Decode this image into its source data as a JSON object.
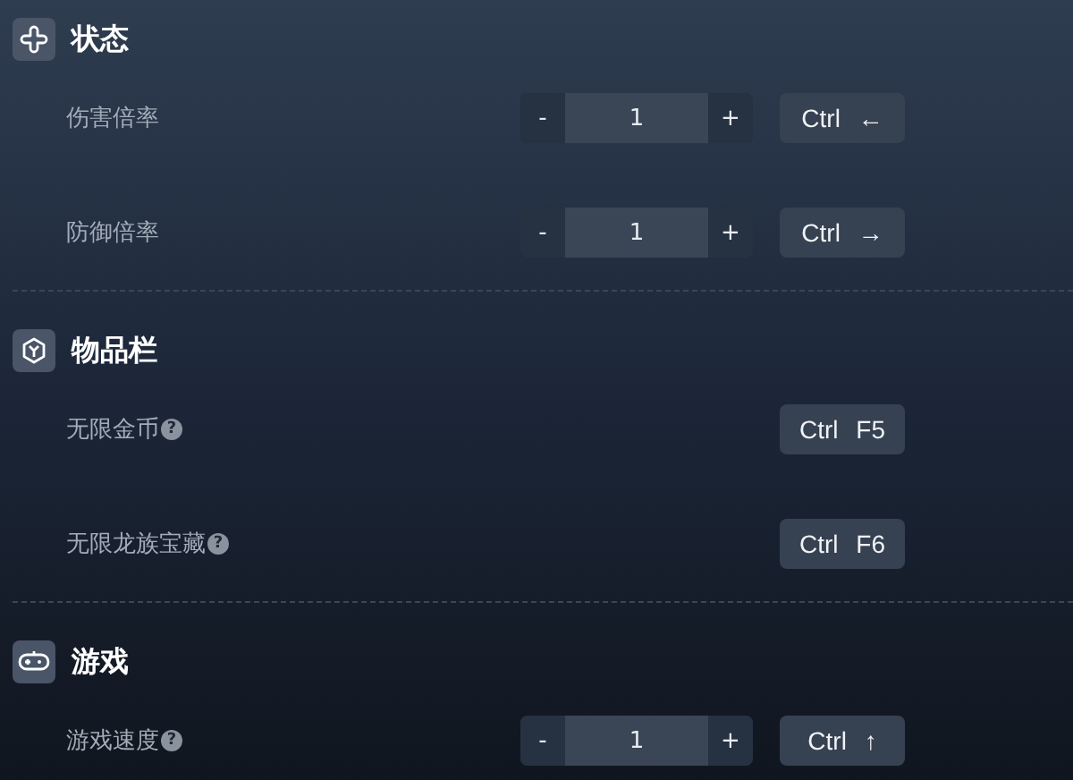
{
  "sections": [
    {
      "title": "状态",
      "kind": "status",
      "rows": [
        {
          "label": "伤害倍率",
          "stepper": {
            "minus": "-",
            "value": "1",
            "plus": "+"
          },
          "hotkey": "Ctrl ←"
        },
        {
          "label": "防御倍率",
          "stepper": {
            "minus": "-",
            "value": "1",
            "plus": "+"
          },
          "hotkey": "Ctrl →"
        }
      ]
    },
    {
      "title": "物品栏",
      "kind": "inventory",
      "rows": [
        {
          "label": "无限金币",
          "help": "?",
          "hotkey": "Ctrl F5"
        },
        {
          "label": "无限龙族宝藏",
          "help": "?",
          "hotkey": "Ctrl F6"
        }
      ]
    },
    {
      "title": "游戏",
      "kind": "game",
      "rows": [
        {
          "label": "游戏速度",
          "help": "?",
          "stepper": {
            "minus": "-",
            "value": "1",
            "plus": "+"
          },
          "hotkey": "Ctrl ↑"
        }
      ]
    }
  ]
}
